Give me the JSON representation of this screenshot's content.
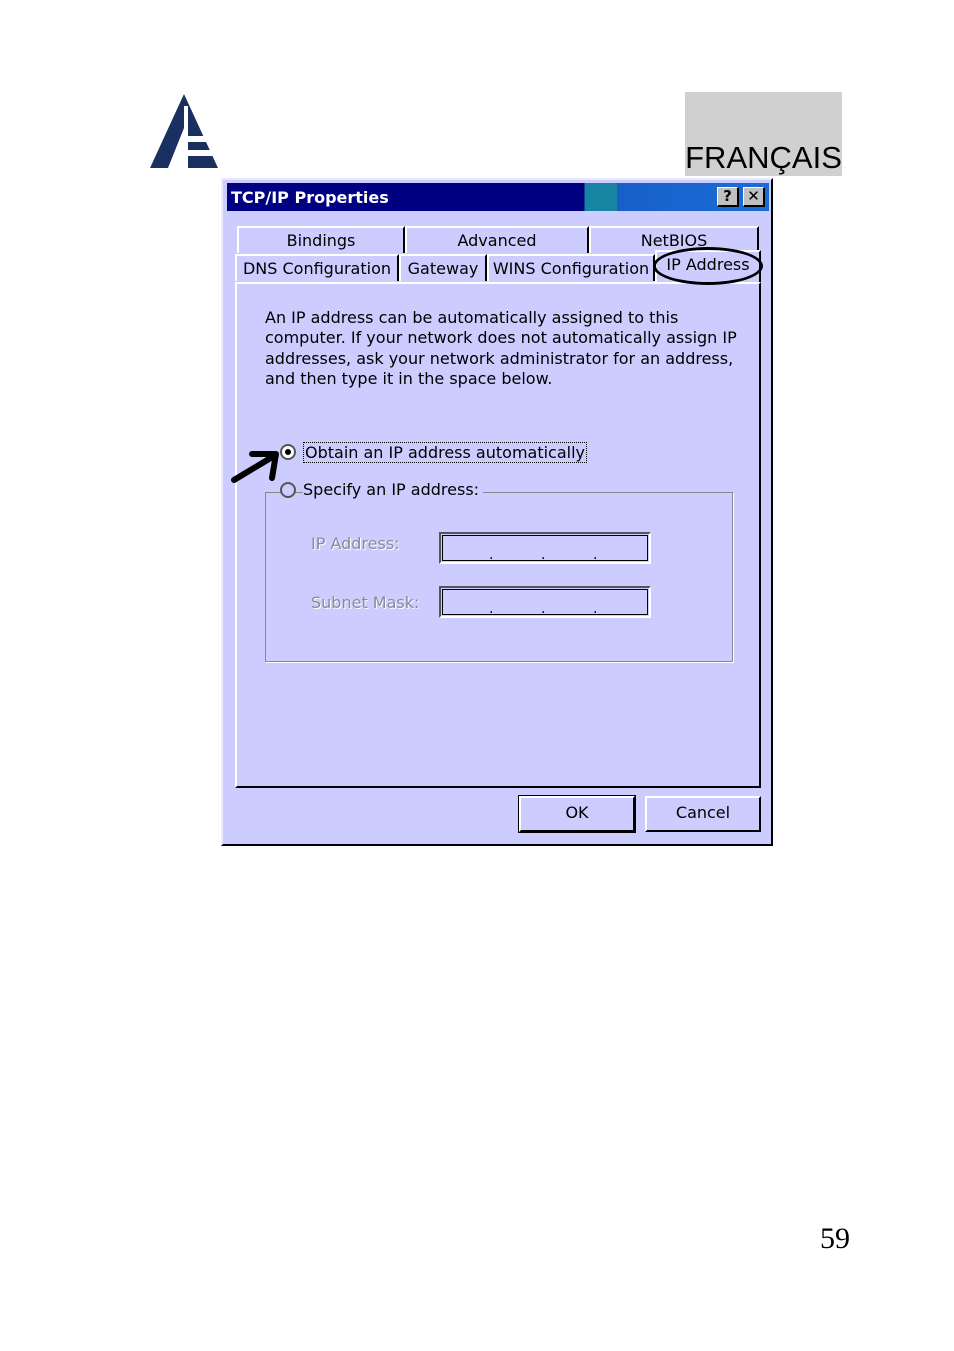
{
  "header": {
    "language": "FRANÇAIS",
    "brand_color": "#1a3060"
  },
  "dialog": {
    "title": "TCP/IP Properties",
    "help_button": "?",
    "close_button": "✕",
    "tabs_row1": [
      "Bindings",
      "Advanced",
      "NetBIOS"
    ],
    "tabs_row2": [
      "DNS Configuration",
      "Gateway",
      "WINS Configuration",
      "IP Address"
    ],
    "active_tab": "IP Address",
    "description": "An IP address can be automatically assigned to this computer. If your network does not automatically assign IP addresses, ask your network administrator for an address, and then type it in the space below.",
    "radio_auto": {
      "label": "Obtain an IP address automatically",
      "selected": true
    },
    "radio_specify": {
      "label": "Specify an IP address:",
      "selected": false
    },
    "ip_address_label": "IP Address:",
    "subnet_mask_label": "Subnet Mask:",
    "ok_label": "OK",
    "cancel_label": "Cancel"
  },
  "footer": {
    "page_number": "59"
  }
}
